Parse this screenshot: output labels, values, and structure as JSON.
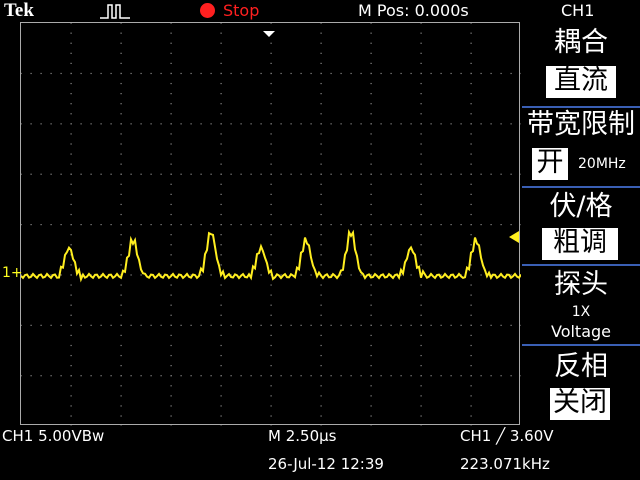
{
  "header": {
    "brand": "Tek",
    "trigger_icon": "trigger-edge-pulse-icon",
    "run_state": "Stop",
    "m_pos": "M Pos: 0.000s",
    "channel": "CH1"
  },
  "menu": {
    "coupling_label": "耦合",
    "coupling_value": "直流",
    "bw_limit_label": "带宽限制",
    "bw_limit_value": "开",
    "bw_limit_freq": "20MHz",
    "volts_div_label": "伏/格",
    "volts_div_value": "粗调",
    "probe_label": "探头",
    "probe_value": "1X",
    "probe_unit": "Voltage",
    "invert_label": "反相",
    "invert_value": "关闭"
  },
  "footer": {
    "ch1_scale": "CH1  5.00VBw",
    "time_scale": "M 2.50µs",
    "trigger_info": "CH1  ╱  3.60V",
    "datetime": "26-Jul-12 12:39",
    "frequency": "223.071kHz"
  },
  "markers": {
    "ch1_ground": "1+"
  },
  "colors": {
    "trace": "#ffee20",
    "grid": "#8a8a8a",
    "menu_divider": "#3a5fb4",
    "stop": "#ff2020"
  }
}
